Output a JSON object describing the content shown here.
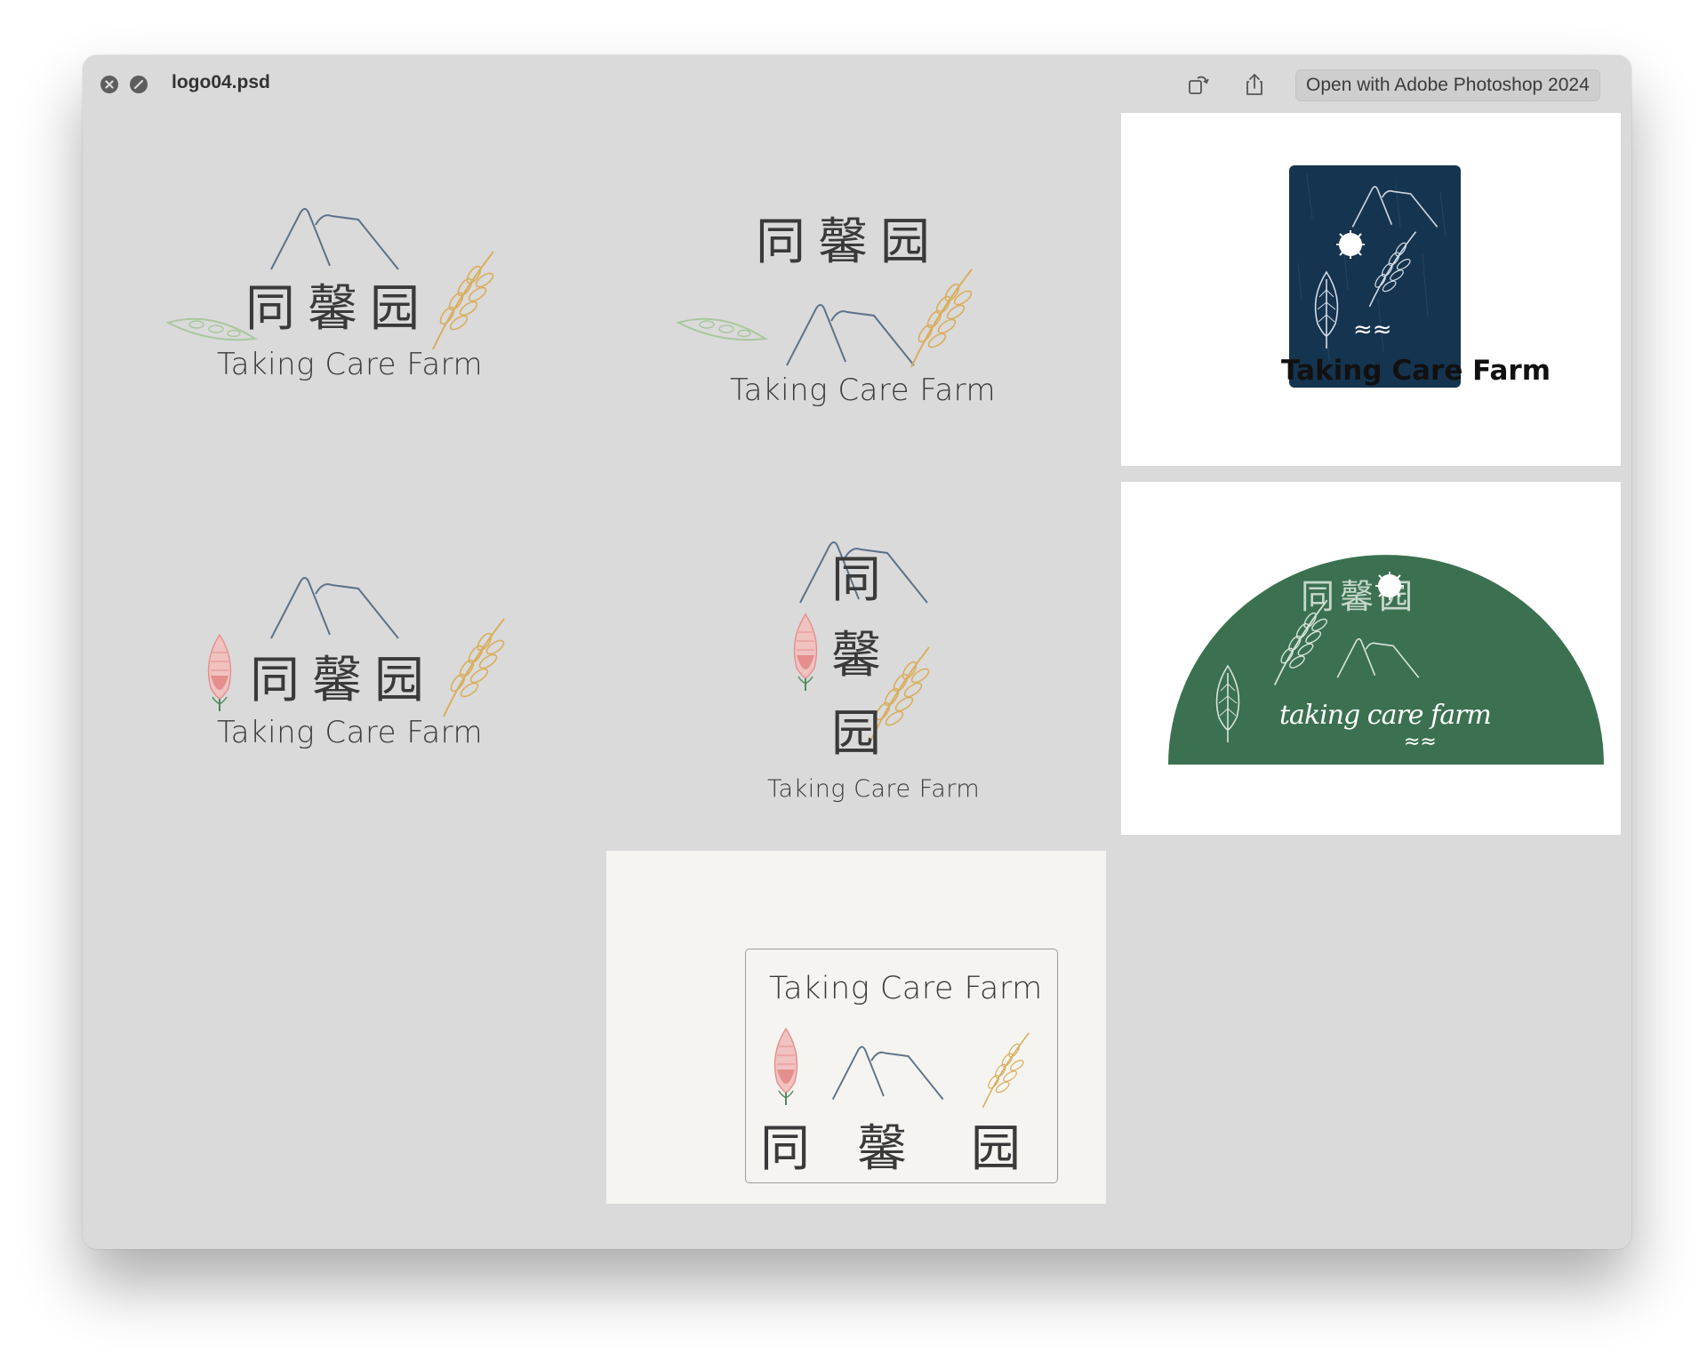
{
  "window": {
    "file_name": "logo04.psd",
    "open_with_label": "Open with Adobe Photoshop 2024"
  },
  "logos": {
    "name_en": "Taking Care Farm",
    "name_zh_1": "同",
    "name_zh_2": "馨",
    "name_zh_3": "园",
    "script_name": "taking care farm",
    "wave_glyph": "≈≈"
  },
  "colors": {
    "window_bg": "#dadada",
    "navy_badge": "#15344f",
    "green_arch": "#3b7150",
    "mountain": "#5c7289",
    "wheat": "#d9ae5c",
    "pea": "#a9c79d",
    "flower": "#e48f8d",
    "card_bg": "#f6f4f1"
  },
  "icons": {
    "close": "close-icon",
    "fullscreen": "fullscreen-icon",
    "rotate": "rotate-icon",
    "share": "share-icon"
  }
}
